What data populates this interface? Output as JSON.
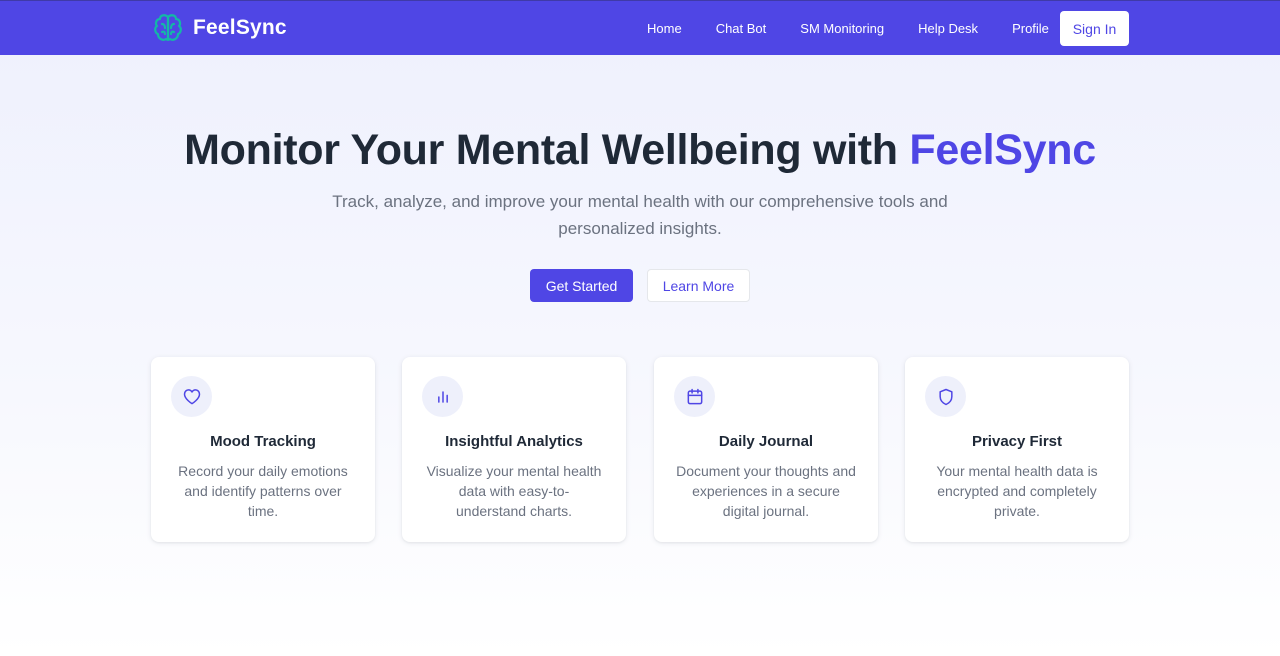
{
  "header": {
    "brand": "FeelSync",
    "nav": [
      "Home",
      "Chat Bot",
      "SM Monitoring",
      "Help Desk",
      "Profile"
    ],
    "signin_label": "Sign In"
  },
  "hero": {
    "title_prefix": "Monitor Your Mental Wellbeing with ",
    "title_accent": "FeelSync",
    "subtitle": "Track, analyze, and improve your mental health with our comprehensive tools and personalized insights.",
    "primary_button": "Get Started",
    "secondary_button": "Learn More"
  },
  "features": [
    {
      "icon": "heart-icon",
      "title": "Mood Tracking",
      "description": "Record your daily emotions and identify patterns over time."
    },
    {
      "icon": "bar-chart-icon",
      "title": "Insightful Analytics",
      "description": "Visualize your mental health data with easy-to-understand charts."
    },
    {
      "icon": "calendar-icon",
      "title": "Daily Journal",
      "description": "Document your thoughts and experiences in a secure digital journal."
    },
    {
      "icon": "shield-icon",
      "title": "Privacy First",
      "description": "Your mental health data is encrypted and completely private."
    }
  ],
  "colors": {
    "brand": "#4f46e5",
    "logo_icon": "#14b8a6",
    "heading": "#1f2937",
    "muted_text": "#6b7280"
  }
}
